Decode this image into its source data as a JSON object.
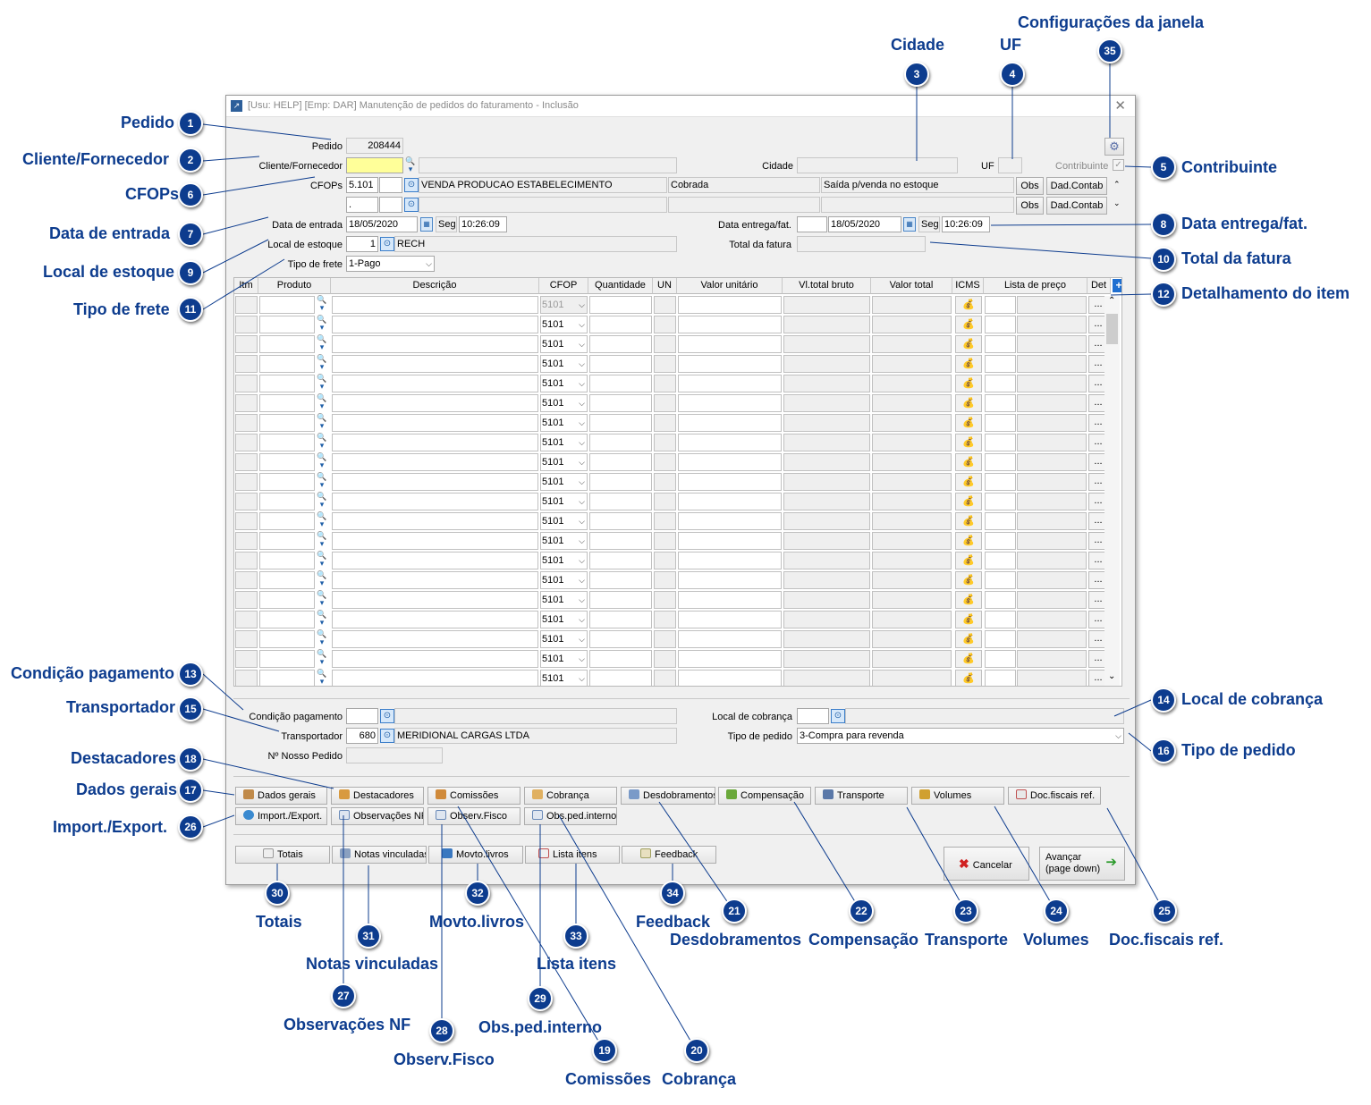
{
  "window": {
    "title": "[Usu: HELP] [Emp: DAR] Manutenção de pedidos do faturamento - Inclusão",
    "close": "✕"
  },
  "header": {
    "pedido_label": "Pedido",
    "pedido_value": "208444",
    "cliente_label": "Cliente/Fornecedor",
    "cidade_label": "Cidade",
    "uf_label": "UF",
    "contribuinte_label": "Contribuinte",
    "cfops_label": "CFOPs",
    "cfop1_code": "5.101",
    "cfop1_desc": "VENDA PRODUCAO ESTABELECIMENTO",
    "cfop1_type": "Cobrada",
    "cfop1_stock": "Saída p/venda no estoque",
    "cfop2_code": ".",
    "obs_label": "Obs",
    "dadcontab_label": "Dad.Contab",
    "data_entrada_label": "Data de entrada",
    "data_entrada": "18/05/2020",
    "dia_entrada": "Seg",
    "hora_entrada": "10:26:09",
    "data_entrega_label": "Data entrega/fat.",
    "data_entrega": "18/05/2020",
    "dia_entrega": "Seg",
    "hora_entrega": "10:26:09",
    "local_estoque_label": "Local de estoque",
    "local_estoque_code": "1",
    "local_estoque_name": "RECH",
    "total_fatura_label": "Total da fatura",
    "tipo_frete_label": "Tipo de frete",
    "tipo_frete_value": "1-Pago"
  },
  "grid": {
    "columns": [
      "Itm",
      "Produto",
      "Descrição",
      "CFOP",
      "Quantidade",
      "UN",
      "Valor unitário",
      "Vl.total bruto",
      "Valor total",
      "ICMS",
      "Lista de preço",
      "Det"
    ],
    "rows": [
      "5101",
      "5101",
      "5101",
      "5101",
      "5101",
      "5101",
      "5101",
      "5101",
      "5101",
      "5101",
      "5101",
      "5101",
      "5101",
      "5101",
      "5101",
      "5101",
      "5101",
      "5101",
      "5101",
      "5101"
    ],
    "det_label": "...",
    "add_icon": "+"
  },
  "footer": {
    "condicao_label": "Condição pagamento",
    "transportador_label": "Transportador",
    "transportador_code": "680",
    "transportador_name": "MERIDIONAL CARGAS LTDA",
    "nosso_pedido_label": "Nº Nosso Pedido",
    "local_cobranca_label": "Local de cobrança",
    "tipo_pedido_label": "Tipo de pedido",
    "tipo_pedido_value": "3-Compra para revenda"
  },
  "tabs_row1": [
    "Dados gerais",
    "Destacadores",
    "Comissões",
    "Cobrança",
    "Desdobramentos",
    "Compensação",
    "Transporte",
    "Volumes",
    "Doc.fiscais ref."
  ],
  "tabs_row2": [
    "Import./Export.",
    "Observações NF",
    "Observ.Fisco",
    "Obs.ped.interno"
  ],
  "tabs_row3": [
    "Totais",
    "Notas vinculadas",
    "Movto.livros",
    "Lista itens",
    "Feedback"
  ],
  "actions": {
    "cancel": "Cancelar",
    "next_line1": "Avançar",
    "next_line2": "(page down)"
  },
  "callouts": [
    {
      "n": "1",
      "label": "Pedido"
    },
    {
      "n": "2",
      "label": "Cliente/Fornecedor"
    },
    {
      "n": "3",
      "label": "Cidade"
    },
    {
      "n": "4",
      "label": "UF"
    },
    {
      "n": "5",
      "label": "Contribuinte"
    },
    {
      "n": "6",
      "label": "CFOPs"
    },
    {
      "n": "7",
      "label": "Data de entrada"
    },
    {
      "n": "8",
      "label": "Data entrega/fat."
    },
    {
      "n": "9",
      "label": "Local de estoque"
    },
    {
      "n": "10",
      "label": "Total da fatura"
    },
    {
      "n": "11",
      "label": "Tipo de frete"
    },
    {
      "n": "12",
      "label": "Detalhamento do item"
    },
    {
      "n": "13",
      "label": "Condição pagamento"
    },
    {
      "n": "14",
      "label": "Local de cobrança"
    },
    {
      "n": "15",
      "label": "Transportador"
    },
    {
      "n": "16",
      "label": "Tipo de pedido"
    },
    {
      "n": "17",
      "label": "Dados gerais"
    },
    {
      "n": "18",
      "label": "Destacadores"
    },
    {
      "n": "19",
      "label": "Comissões"
    },
    {
      "n": "20",
      "label": "Cobrança"
    },
    {
      "n": "21",
      "label": "Desdobramentos"
    },
    {
      "n": "22",
      "label": "Compensação"
    },
    {
      "n": "23",
      "label": "Transporte"
    },
    {
      "n": "24",
      "label": "Volumes"
    },
    {
      "n": "25",
      "label": "Doc.fiscais ref."
    },
    {
      "n": "26",
      "label": "Import./Export."
    },
    {
      "n": "27",
      "label": "Observações NF"
    },
    {
      "n": "28",
      "label": "Observ.Fisco"
    },
    {
      "n": "29",
      "label": "Obs.ped.interno"
    },
    {
      "n": "30",
      "label": "Totais"
    },
    {
      "n": "31",
      "label": "Notas vinculadas"
    },
    {
      "n": "32",
      "label": "Movto.livros"
    },
    {
      "n": "33",
      "label": "Lista itens"
    },
    {
      "n": "34",
      "label": "Feedback"
    },
    {
      "n": "35",
      "label": "Configurações da janela"
    }
  ]
}
